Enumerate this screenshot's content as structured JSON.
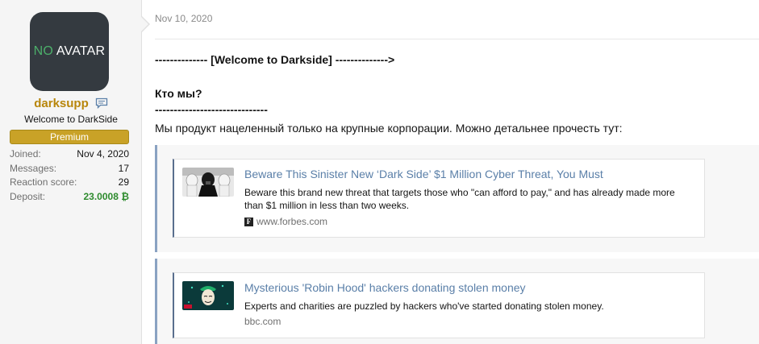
{
  "user": {
    "avatar_prefix": "NO",
    "avatar_suffix": " AVATAR",
    "username": "darksupp",
    "title": "Welcome to DarkSide",
    "banner": "Premium",
    "stats": [
      {
        "key": "Joined:",
        "value": "Nov 4, 2020"
      },
      {
        "key": "Messages:",
        "value": "17"
      },
      {
        "key": "Reaction score:",
        "value": "29"
      },
      {
        "key": "Deposit:",
        "value": "23.0008 ₿"
      }
    ]
  },
  "post": {
    "date": "Nov 10, 2020",
    "heading": "-------------- [Welcome to Darkside] -------------->",
    "question": "Кто мы?",
    "separator": "------------------------------",
    "intro": "Мы продукт нацеленный только на крупные корпорации. Можно детальнее прочесть тут:"
  },
  "links": [
    {
      "title": "Beware This Sinister New ‘Dark Side’ $1 Million Cyber Threat, You Must",
      "description": "Beware this brand new threat that targets those who \"can afford to pay,\" and has already made more than $1 million in less than two weeks.",
      "domain": "www.forbes.com",
      "favicon": "F"
    },
    {
      "title": "Mysterious 'Robin Hood' hackers donating stolen money",
      "description": "Experts and charities are puzzled by hackers who've started donating stolen money.",
      "domain": "bbc.com"
    }
  ],
  "colors": {
    "username": "#b8860b",
    "banner": "#c9a227",
    "deposit": "#2e8b2e",
    "link": "#5a7fa8",
    "quote_bar": "#8aa2c2"
  },
  "icons": {
    "message": "message-icon",
    "forbes_favicon": "forbes-favicon-icon"
  }
}
